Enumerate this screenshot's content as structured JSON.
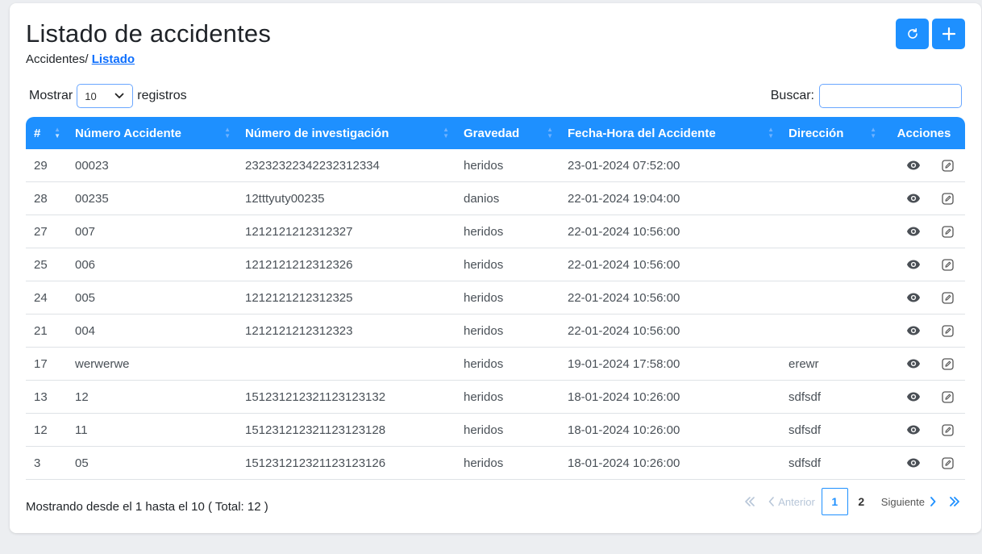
{
  "header": {
    "title": "Listado de accidentes",
    "breadcrumb_parent": "Accidentes/",
    "breadcrumb_current": "Listado"
  },
  "toolbar": {
    "refresh_icon": "refresh-icon",
    "add_icon": "plus-icon"
  },
  "length_control": {
    "prefix": "Mostrar",
    "selected": "10",
    "suffix": "registros"
  },
  "search": {
    "label": "Buscar:",
    "value": "",
    "placeholder": ""
  },
  "table": {
    "columns": [
      "#",
      "Número Accidente",
      "Número de investigación",
      "Gravedad",
      "Fecha-Hora del Accidente",
      "Dirección",
      "Acciones"
    ],
    "rows": [
      {
        "id": "29",
        "numero": "00023",
        "investigacion": "23232322342232312334",
        "gravedad": "heridos",
        "fecha": "23-01-2024 07:52:00",
        "direccion": ""
      },
      {
        "id": "28",
        "numero": "00235",
        "investigacion": "12tttyuty00235",
        "gravedad": "danios",
        "fecha": "22-01-2024 19:04:00",
        "direccion": ""
      },
      {
        "id": "27",
        "numero": "007",
        "investigacion": "1212121212312327",
        "gravedad": "heridos",
        "fecha": "22-01-2024 10:56:00",
        "direccion": ""
      },
      {
        "id": "25",
        "numero": "006",
        "investigacion": "1212121212312326",
        "gravedad": "heridos",
        "fecha": "22-01-2024 10:56:00",
        "direccion": ""
      },
      {
        "id": "24",
        "numero": "005",
        "investigacion": "1212121212312325",
        "gravedad": "heridos",
        "fecha": "22-01-2024 10:56:00",
        "direccion": ""
      },
      {
        "id": "21",
        "numero": "004",
        "investigacion": "1212121212312323",
        "gravedad": "heridos",
        "fecha": "22-01-2024 10:56:00",
        "direccion": ""
      },
      {
        "id": "17",
        "numero": "werwerwe",
        "investigacion": "",
        "gravedad": "heridos",
        "fecha": "19-01-2024 17:58:00",
        "direccion": "erewr"
      },
      {
        "id": "13",
        "numero": "12",
        "investigacion": "151231212321123123132",
        "gravedad": "heridos",
        "fecha": "18-01-2024 10:26:00",
        "direccion": "sdfsdf"
      },
      {
        "id": "12",
        "numero": "11",
        "investigacion": "151231212321123123128",
        "gravedad": "heridos",
        "fecha": "18-01-2024 10:26:00",
        "direccion": "sdfsdf"
      },
      {
        "id": "3",
        "numero": "05",
        "investigacion": "151231212321123123126",
        "gravedad": "heridos",
        "fecha": "18-01-2024 10:26:00",
        "direccion": "sdfsdf"
      }
    ],
    "row_actions": [
      "eye-icon",
      "edit-icon"
    ]
  },
  "footer": {
    "info": "Mostrando desde el 1 hasta el 10 ( Total: 12 )"
  },
  "pagination": {
    "previous": "Anterior",
    "pages": [
      "1",
      "2"
    ],
    "active_page": "1",
    "next": "Siguiente"
  },
  "colors": {
    "primary": "#1e90ff",
    "link": "#0d6efd",
    "disabled": "#b7c6d8"
  }
}
